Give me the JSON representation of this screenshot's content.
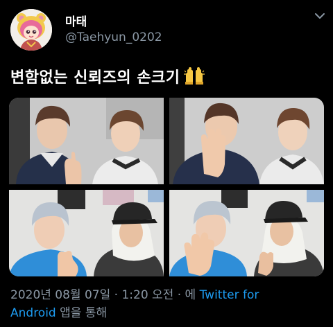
{
  "tweet": {
    "display_name": "마태",
    "handle": "@Taehyun_0202",
    "text": "변함없는 신뢰즈의 손크기",
    "emoji": "raising-hands-icon",
    "media_count": 4,
    "meta": {
      "timestamp": "2020년 08월 07일 · 1:20 오전 · 에",
      "client_link_1": "Twitter for",
      "client_link_2": "Android",
      "suffix": "앱을 통해"
    }
  },
  "colors": {
    "background": "#000000",
    "text": "#ffffff",
    "secondary": "#8b98a5",
    "link": "#1d9bf0"
  }
}
